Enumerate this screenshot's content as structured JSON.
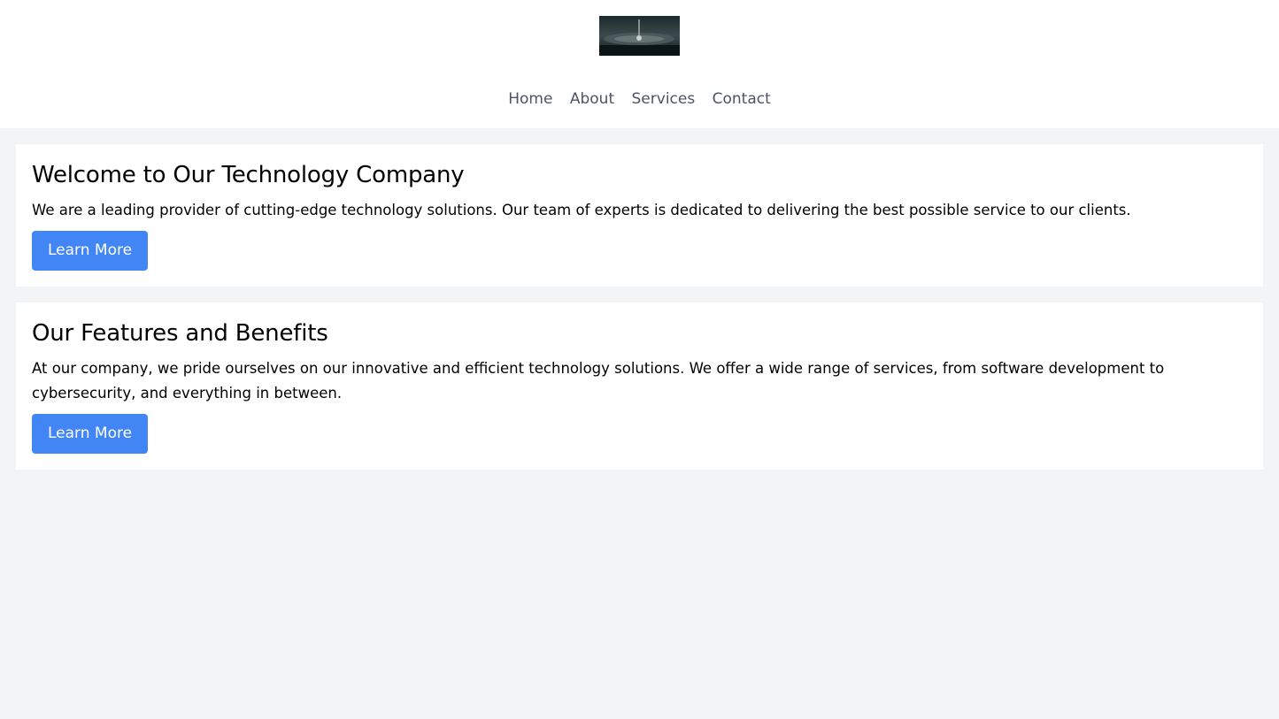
{
  "header": {
    "logo_alt": "company-logo",
    "nav": [
      {
        "label": "Home"
      },
      {
        "label": "About"
      },
      {
        "label": "Services"
      },
      {
        "label": "Contact"
      }
    ]
  },
  "sections": [
    {
      "title": "Welcome to Our Technology Company",
      "body": "We are a leading provider of cutting-edge technology solutions. Our team of experts is dedicated to delivering the best possible service to our clients.",
      "button": "Learn More"
    },
    {
      "title": "Our Features and Benefits",
      "body": "At our company, we pride ourselves on our innovative and efficient technology solutions. We offer a wide range of services, from software development to cybersecurity, and everything in between.",
      "button": "Learn More"
    }
  ],
  "colors": {
    "background": "#f3f4f6",
    "surface": "#ffffff",
    "nav_text": "#4b5563",
    "button": "#4285f4",
    "button_text": "#ffffff"
  }
}
